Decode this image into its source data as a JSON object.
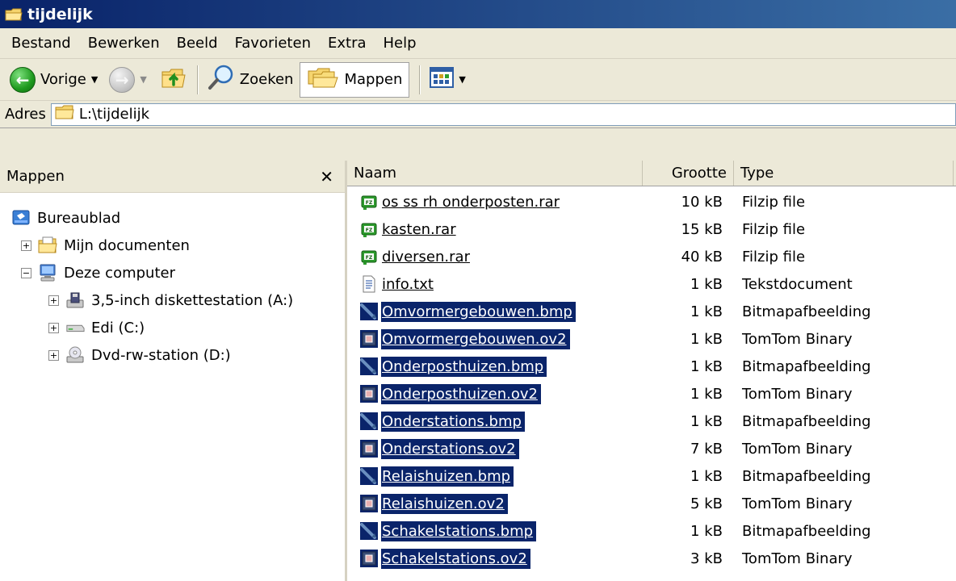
{
  "window": {
    "title": "tijdelijk"
  },
  "menubar": {
    "items": [
      "Bestand",
      "Bewerken",
      "Beeld",
      "Favorieten",
      "Extra",
      "Help"
    ]
  },
  "toolbar": {
    "back_label": "Vorige",
    "search_label": "Zoeken",
    "folders_label": "Mappen"
  },
  "address": {
    "label": "Adres",
    "value": "L:\\tijdelijk"
  },
  "folders_pane": {
    "title": "Mappen",
    "tree": [
      {
        "label": "Bureaublad",
        "icon": "desktop-icon",
        "level": 0,
        "expander": ""
      },
      {
        "label": "Mijn documenten",
        "icon": "my-documents-icon",
        "level": 1,
        "expander": "+"
      },
      {
        "label": "Deze computer",
        "icon": "my-computer-icon",
        "level": 1,
        "expander": "-"
      },
      {
        "label": "3,5-inch diskettestation (A:)",
        "icon": "floppy-drive-icon",
        "level": 2,
        "expander": "+"
      },
      {
        "label": "Edi (C:)",
        "icon": "hard-drive-icon",
        "level": 2,
        "expander": "+"
      },
      {
        "label": "Dvd-rw-station (D:)",
        "icon": "dvd-drive-icon",
        "level": 2,
        "expander": "+"
      }
    ]
  },
  "file_list": {
    "columns": {
      "name": "Naam",
      "size": "Grootte",
      "type": "Type"
    },
    "rows": [
      {
        "name": "os ss rh onderposten.rar",
        "size": "10 kB",
        "type": "Filzip file",
        "icon": "zip-archive-icon",
        "selected": false
      },
      {
        "name": "kasten.rar",
        "size": "15 kB",
        "type": "Filzip file",
        "icon": "zip-archive-icon",
        "selected": false
      },
      {
        "name": "diversen.rar",
        "size": "40 kB",
        "type": "Filzip file",
        "icon": "zip-archive-icon",
        "selected": false
      },
      {
        "name": "info.txt",
        "size": "1 kB",
        "type": "Tekstdocument",
        "icon": "text-file-icon",
        "selected": false
      },
      {
        "name": "Omvormergebouwen.bmp",
        "size": "1 kB",
        "type": "Bitmapafbeelding",
        "icon": "bitmap-file-icon",
        "selected": true
      },
      {
        "name": "Omvormergebouwen.ov2",
        "size": "1 kB",
        "type": "TomTom Binary",
        "icon": "tomtom-file-icon",
        "selected": true
      },
      {
        "name": "Onderposthuizen.bmp",
        "size": "1 kB",
        "type": "Bitmapafbeelding",
        "icon": "bitmap-file-icon",
        "selected": true
      },
      {
        "name": "Onderposthuizen.ov2",
        "size": "1 kB",
        "type": "TomTom Binary",
        "icon": "tomtom-file-icon",
        "selected": true
      },
      {
        "name": "Onderstations.bmp",
        "size": "1 kB",
        "type": "Bitmapafbeelding",
        "icon": "bitmap-file-icon",
        "selected": true
      },
      {
        "name": "Onderstations.ov2",
        "size": "7 kB",
        "type": "TomTom Binary",
        "icon": "tomtom-file-icon",
        "selected": true
      },
      {
        "name": "Relaishuizen.bmp",
        "size": "1 kB",
        "type": "Bitmapafbeelding",
        "icon": "bitmap-file-icon",
        "selected": true
      },
      {
        "name": "Relaishuizen.ov2",
        "size": "5 kB",
        "type": "TomTom Binary",
        "icon": "tomtom-file-icon",
        "selected": true
      },
      {
        "name": "Schakelstations.bmp",
        "size": "1 kB",
        "type": "Bitmapafbeelding",
        "icon": "bitmap-file-icon",
        "selected": true
      },
      {
        "name": "Schakelstations.ov2",
        "size": "3 kB",
        "type": "TomTom Binary",
        "icon": "tomtom-file-icon",
        "selected": true
      }
    ]
  },
  "colors": {
    "selection": "#0a246a",
    "titlebar": "#0a246a",
    "chrome": "#ece9d8"
  }
}
